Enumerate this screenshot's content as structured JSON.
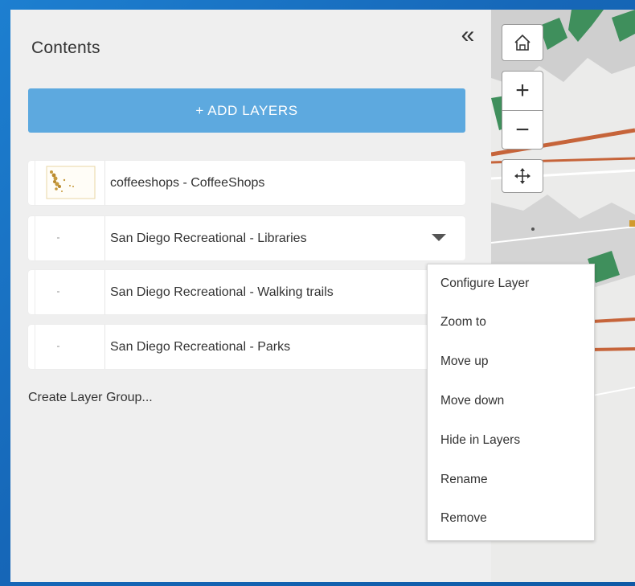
{
  "panel": {
    "title": "Contents",
    "collapse_icon": "double-chevron-left-icon",
    "collapse_glyph": "«",
    "add_layers_label": "+ ADD LAYERS",
    "create_group_label": "Create Layer Group..."
  },
  "layers": [
    {
      "label": "coffeeshops - CoffeeShops",
      "has_menu": false
    },
    {
      "label": "San Diego Recreational - Libraries",
      "has_menu": true
    },
    {
      "label": "San Diego Recreational - Walking trails",
      "has_menu": false
    },
    {
      "label": "San Diego Recreational - Parks",
      "has_menu": false
    }
  ],
  "map_controls": {
    "home_icon": "home-icon",
    "zoom_in": "+",
    "zoom_out": "−",
    "pan_icon": "pan-icon"
  },
  "layer_menu": {
    "items": [
      "Configure Layer",
      "Zoom to",
      "Move up",
      "Move down",
      "Hide in Layers",
      "Rename",
      "Remove"
    ]
  },
  "colors": {
    "accent": "#5da9df",
    "background_blue": "#1667b8",
    "panel_bg": "#efefef",
    "park_green": "#3f8f5c",
    "trail_orange": "#c6643a"
  }
}
